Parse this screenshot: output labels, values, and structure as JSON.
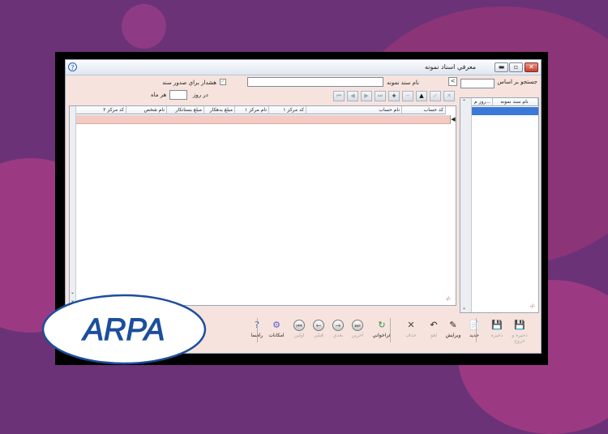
{
  "window": {
    "title": "معرفي اسناد نمونه",
    "app_icon_glyph": "?"
  },
  "search": {
    "label": "جستجو بر اساس",
    "value": ""
  },
  "form": {
    "doc_name_label": "نام سند نمونه",
    "doc_name_value": "",
    "warning_label": "هشدار براي صدور سند",
    "warning_checked": true,
    "interval_prefix": "در روز",
    "interval_value": "",
    "interval_suffix": "هر ماه"
  },
  "nav": {
    "buttons": [
      {
        "name": "first-record-button",
        "glyph": "⏮",
        "enabled": false
      },
      {
        "name": "prev-record-button",
        "glyph": "◀",
        "enabled": false
      },
      {
        "name": "next-record-button",
        "glyph": "▶",
        "enabled": false
      },
      {
        "name": "last-record-button",
        "glyph": "⏭",
        "enabled": false
      },
      {
        "name": "insert-record-button",
        "glyph": "+",
        "enabled": true
      },
      {
        "name": "delete-record-button",
        "glyph": "−",
        "enabled": false
      },
      {
        "name": "edit-record-button",
        "glyph": "▲",
        "enabled": true
      },
      {
        "name": "post-record-button",
        "glyph": "✓",
        "enabled": false
      },
      {
        "name": "cancel-record-button",
        "glyph": "✕",
        "enabled": false
      }
    ]
  },
  "main_grid": {
    "columns": [
      "کد حساب",
      "نام حساب",
      "کد مرکز ۱",
      "نام مرکز ۱",
      "مبلغ بدهکار",
      "مبلغ بستانکار",
      "نام شخص",
      "کد مرکز ۲"
    ],
    "footer": "-/-"
  },
  "side_grid": {
    "columns": [
      "نام سند نمونه",
      "روز م..."
    ],
    "footer": "-/-"
  },
  "toolbar": {
    "items": [
      {
        "name": "save-and-exit-button",
        "icon": "floppy-icon",
        "glyph": "💾",
        "label": "ذخيره و خروج",
        "enabled": false
      },
      {
        "name": "save-button",
        "icon": "floppy-icon",
        "glyph": "💾",
        "label": "ذخيره",
        "enabled": false
      },
      {
        "name": "new-button",
        "icon": "new-document-icon",
        "glyph": "📄",
        "label": "جديد",
        "enabled": true
      },
      {
        "name": "edit-button",
        "icon": "edit-pencil-icon",
        "glyph": "✎",
        "label": "ويرايش",
        "enabled": true
      },
      {
        "name": "cancel-button",
        "icon": "cancel-icon",
        "glyph": "↶",
        "label": "لغو",
        "enabled": false
      },
      {
        "name": "delete-button",
        "icon": "delete-x-icon",
        "glyph": "✕",
        "label": "حذف",
        "enabled": false
      },
      {
        "name": "load-button",
        "icon": "recycle-icon",
        "glyph": "↻",
        "label": "فراخواني",
        "enabled": true
      },
      {
        "name": "last-button",
        "icon": "last-arrow-icon",
        "glyph": "⏭",
        "label": "آخرين",
        "enabled": false
      },
      {
        "name": "next-button",
        "icon": "next-arrow-icon",
        "glyph": "→",
        "label": "بعدي",
        "enabled": false
      },
      {
        "name": "previous-button",
        "icon": "previous-arrow-icon",
        "glyph": "←",
        "label": "قبلي",
        "enabled": false
      },
      {
        "name": "first-button",
        "icon": "first-arrow-icon",
        "glyph": "⏮",
        "label": "اولين",
        "enabled": false
      },
      {
        "name": "facilities-button",
        "icon": "gear-icon",
        "glyph": "⚙",
        "label": "امكانات",
        "enabled": true
      },
      {
        "name": "help-button",
        "icon": "question-icon",
        "glyph": "?",
        "label": "راهنما",
        "enabled": true
      }
    ]
  },
  "logo": {
    "text": "ARPA",
    "color": "#1d4e9c"
  },
  "colors": {
    "background": "#6b3277",
    "window": "#f6e3dd",
    "selection": "#3a79d8",
    "row_highlight": "#f3cbc4"
  }
}
